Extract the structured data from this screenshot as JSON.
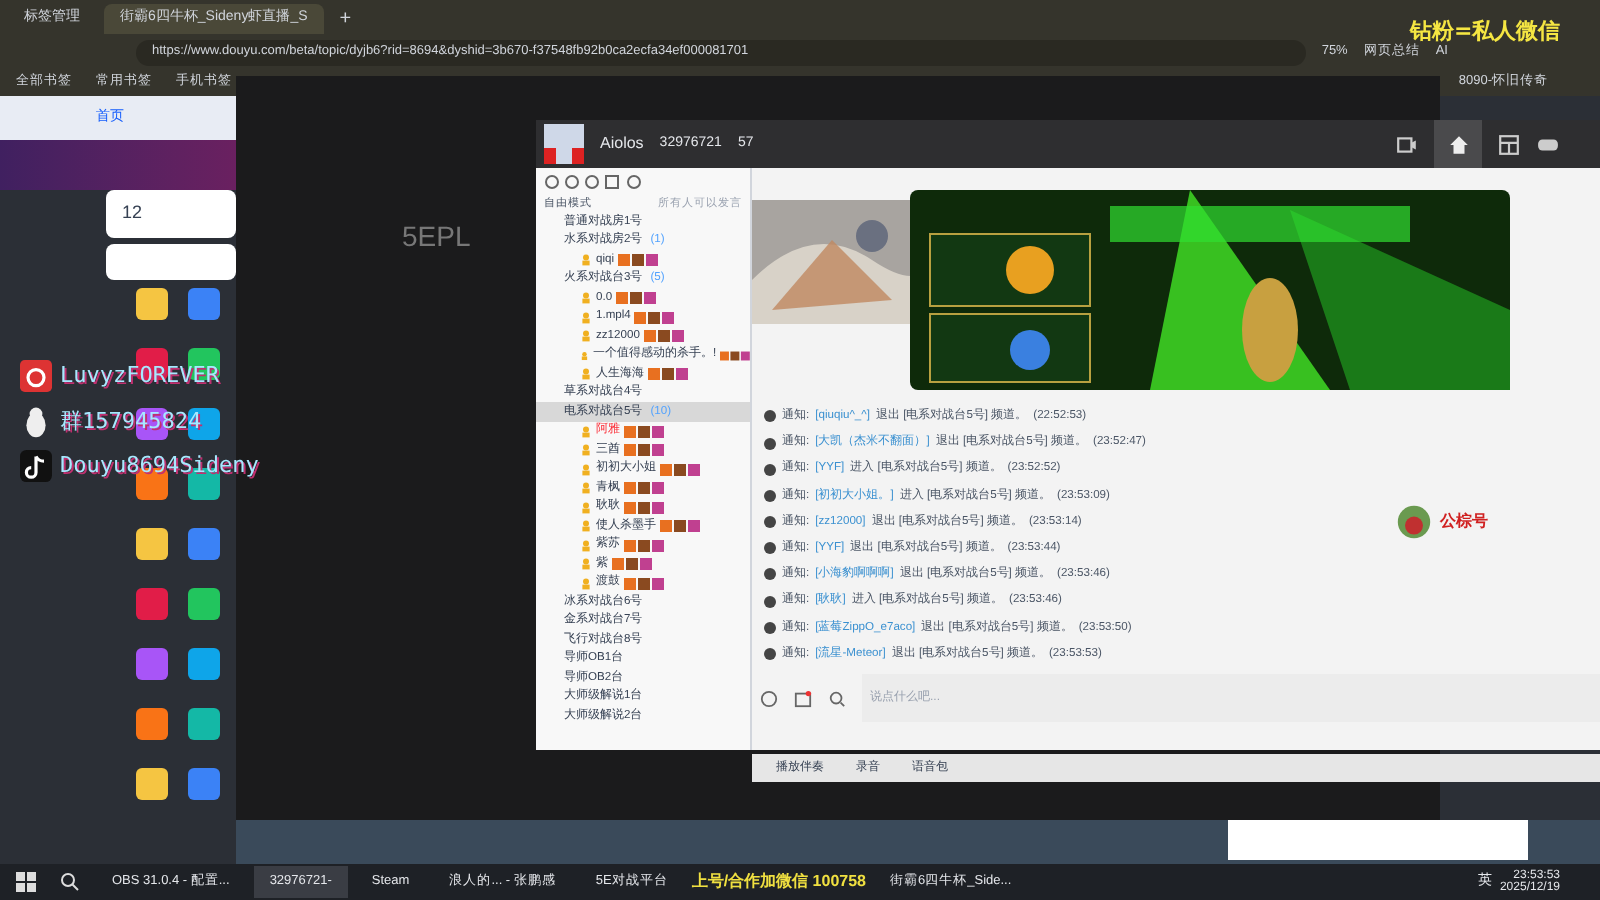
{
  "browser": {
    "tabs": [
      {
        "label": "标签管理",
        "selected": false
      },
      {
        "label": "街霸6四牛杯_Sideny虾直播_S",
        "selected": true
      }
    ],
    "new_tab": "+",
    "url": "https://www.douyu.com/beta/topic/dyjb6?rid=8694&dyshid=3b670-f37548fb92b0ca2ecfa34ef000081701",
    "zoom": "75%",
    "tools": [
      "网页总结",
      "AI"
    ],
    "bookmarks": [
      "全部书签",
      "常用书签",
      "手机书签"
    ],
    "bookmark_right": "8090-怀旧传奇"
  },
  "site": {
    "nav": "首页",
    "stat": "12"
  },
  "overlay_top": "钻粉=私人微信",
  "social_overlay": [
    {
      "kind": "music",
      "text": "LuvyzFOREVER"
    },
    {
      "kind": "penguin",
      "text": "群157945824"
    },
    {
      "kind": "note",
      "text": "Douyu8694Sideny"
    }
  ],
  "game_window": {
    "title": "5EPL"
  },
  "chat": {
    "user": "Aiolos",
    "room_id": "32976721",
    "online": "57",
    "mode": "自由模式",
    "mode_hint": "所有人可以发言",
    "channels": [
      {
        "name": "普通对战房1号",
        "selected": false
      },
      {
        "name": "水系对战房2号",
        "count": "(1)",
        "selected": false,
        "children": [
          {
            "name": "qiqi"
          }
        ]
      },
      {
        "name": "火系对战台3号",
        "count": "(5)",
        "selected": false,
        "children": [
          {
            "name": "0.0"
          },
          {
            "name": "1.mpl4"
          },
          {
            "name": "zz12000"
          },
          {
            "name": "一个值得感动的杀手。!"
          },
          {
            "name": "人生海海"
          }
        ]
      },
      {
        "name": "草系对战台4号",
        "selected": false
      },
      {
        "name": "电系对战台5号",
        "count": "(10)",
        "selected": true,
        "children": [
          {
            "name": "阿雅"
          },
          {
            "name": "三酋"
          },
          {
            "name": "初初大小姐"
          },
          {
            "name": "青枫"
          },
          {
            "name": "耿耿"
          },
          {
            "name": "使人杀墨手"
          },
          {
            "name": "紫苏"
          },
          {
            "name": "紫"
          },
          {
            "name": "渡鼓"
          }
        ]
      },
      {
        "name": "冰系对战台6号",
        "selected": false
      },
      {
        "name": "金系对战台7号",
        "selected": false
      },
      {
        "name": "飞行对战台8号",
        "selected": false
      },
      {
        "name": "导师OB1台",
        "selected": false
      },
      {
        "name": "导师OB2台",
        "selected": false
      },
      {
        "name": "大师级解说1台",
        "selected": false
      },
      {
        "name": "大师级解说2台",
        "selected": false
      }
    ],
    "messages": [
      {
        "label": "通知:",
        "user": "[qiuqiu^_^]",
        "text": "退出 [电系对战台5号] 频道。",
        "time": "(22:52:53)"
      },
      {
        "label": "通知:",
        "user": "[大凯（杰米不翻面）]",
        "text": "退出 [电系对战台5号] 频道。",
        "time": "(23:52:47)"
      },
      {
        "label": "通知:",
        "user": "[YYF]",
        "text": "进入 [电系对战台5号] 频道。",
        "time": "(23:52:52)"
      },
      {
        "label": "通知:",
        "user": "[初初大小姐。]",
        "text": "进入 [电系对战台5号] 频道。",
        "time": "(23:53:09)"
      },
      {
        "label": "通知:",
        "user": "[zz12000]",
        "text": "退出 [电系对战台5号] 频道。",
        "time": "(23:53:14)"
      },
      {
        "label": "通知:",
        "user": "[YYF]",
        "text": "退出 [电系对战台5号] 频道。",
        "time": "(23:53:44)"
      },
      {
        "label": "通知:",
        "user": "[小海豹啊啊啊]",
        "text": "退出 [电系对战台5号] 频道。",
        "time": "(23:53:46)"
      },
      {
        "label": "通知:",
        "user": "[耿耿]",
        "text": "进入 [电系对战台5号] 频道。",
        "time": "(23:53:46)"
      },
      {
        "label": "通知:",
        "user": "[蓝莓ZippO_e7aco]",
        "text": "退出 [电系对战台5号] 频道。",
        "time": "(23:53:50)"
      },
      {
        "label": "通知:",
        "user": "[流星-Meteor]",
        "text": "退出 [电系对战台5号] 频道。",
        "time": "(23:53:53)"
      }
    ],
    "side_label": "公棕号",
    "input": {
      "placeholder": "说点什么吧..."
    },
    "toolbar": [
      "播放伴奏",
      "录音",
      "语音包"
    ]
  },
  "taskbar": {
    "items": [
      {
        "label": "OBS 31.0.4 - 配置...",
        "selected": false
      },
      {
        "label": "32976721-",
        "selected": true
      },
      {
        "label": "Steam",
        "selected": false
      },
      {
        "label": "浪人的... - 张鹏感",
        "selected": false
      },
      {
        "label": "5E对战平台",
        "selected": false
      },
      {
        "label": "街霸6四牛杯_Side...",
        "selected": false
      }
    ],
    "overlay_text": "上号/合作加微信 100758",
    "ime": "英",
    "time": "23:53:53",
    "date": "2025/12/19"
  }
}
